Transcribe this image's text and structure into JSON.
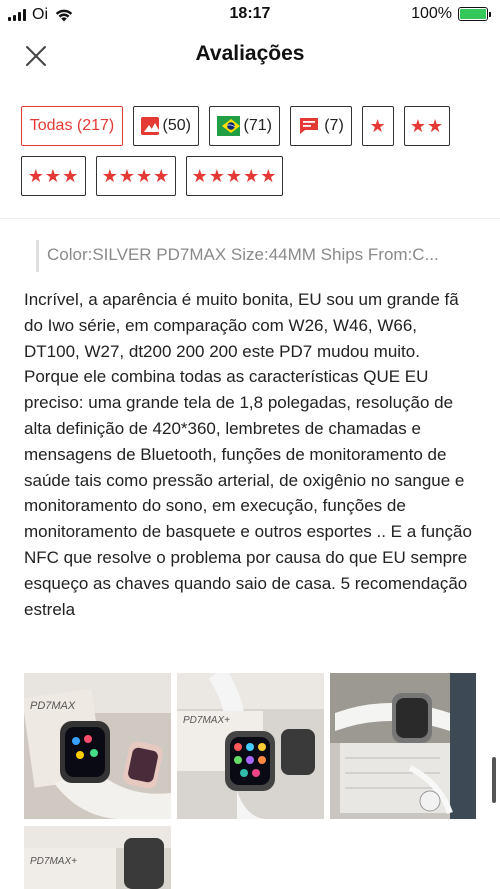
{
  "status_bar": {
    "carrier": "Oi",
    "time": "18:17",
    "battery": "100%"
  },
  "header": {
    "title": "Avaliações"
  },
  "filters": {
    "all": "Todas (217)",
    "photos_count": "(50)",
    "brazil_count": "(71)",
    "comments_count": "(7)",
    "star1": "★",
    "star2": "★★",
    "star3": "★★★",
    "star4": "★★★★",
    "star5": "★★★★★"
  },
  "review": {
    "variant": "Color:SILVER PD7MAX Size:44MM Ships From:C...",
    "text": "Incrível, a aparência é muito bonita, EU sou um grande fã do Iwo série, em comparação com W26, W46, W66, DT100, W27, dt200 200 200 este PD7 mudou muito. Porque ele combina todas as características QUE EU preciso: uma grande tela de 1,8 polegadas, resolução de alta definição de 420*360, lembretes de chamadas e mensagens de Bluetooth, funções de monitoramento de saúde tais como pressão arterial, de oxigênio no sangue e monitoramento do sono, em execução, funções de monitoramento de basquete e outros esportes .. E a função NFC que resolve o problema por causa do que EU sempre esqueço as chaves quando saio de casa. 5 recomendação estrela"
  },
  "photos": {
    "box_label_1": "PD7MAX",
    "box_label_2": "PD7MAX+",
    "box_label_4": "PD7MAX+"
  },
  "colors": {
    "accent": "#e53935",
    "battery": "#34c759"
  }
}
